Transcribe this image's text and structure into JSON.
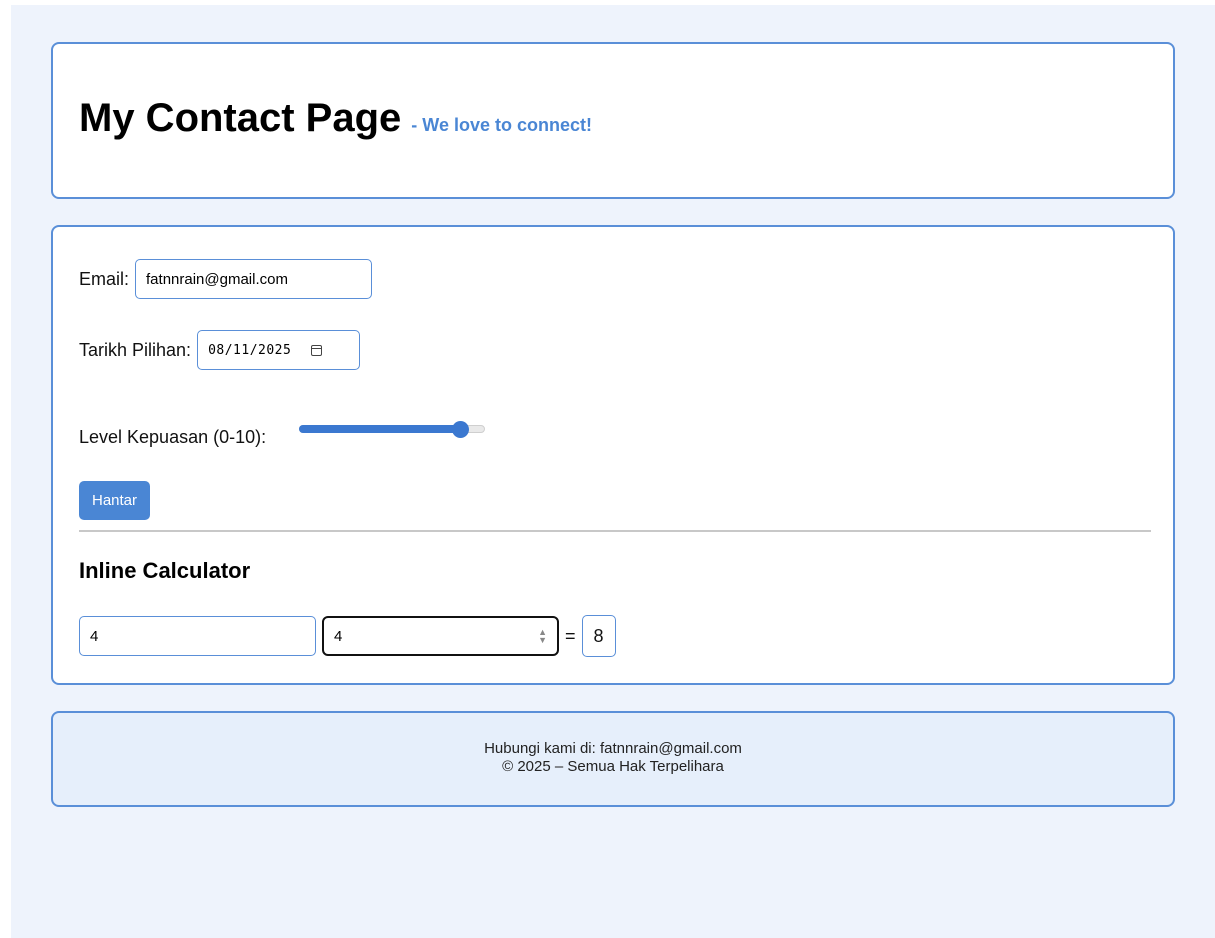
{
  "header": {
    "title": "My Contact Page",
    "tagline": "- We love to connect!"
  },
  "form": {
    "email_label": "Email:",
    "email_value": "fatnnrain@gmail.com",
    "date_label": "Tarikh Pilihan:",
    "date_value": "08/11/2025",
    "calendar_icon": "calendar-icon",
    "satisfaction_label": "Level Kepuasan (0-10):",
    "satisfaction_min": 0,
    "satisfaction_max": 10,
    "satisfaction_value": 9,
    "submit_label": "Hantar"
  },
  "calculator": {
    "title": "Inline Calculator",
    "operand_a": "4",
    "operand_b": "4",
    "equals": "=",
    "result": "8"
  },
  "footer": {
    "contact_line": "Hubungi kami di: fatnnrain@gmail.com",
    "copyright_line": "© 2025 – Semua Hak Terpelihara"
  },
  "colors": {
    "accent": "#4a86d4",
    "border": "#5a8fd8",
    "page_background": "#eef3fc",
    "footer_background": "#e6effb"
  }
}
